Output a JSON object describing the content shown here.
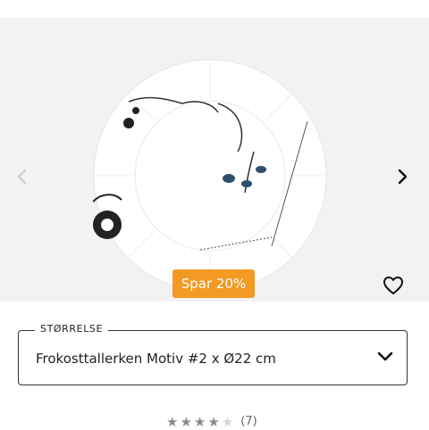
{
  "product": {
    "image": "plate-photo",
    "discount_badge": "Spar 20%",
    "wishlist_icon": "heart-outline-icon",
    "nav_prev_icon": "chevron-left-icon",
    "nav_next_icon": "chevron-right-icon"
  },
  "size_select": {
    "legend": "STØRRELSE",
    "value": "Frokosttallerken Motiv #2 x Ø22 cm",
    "icon": "chevron-down-icon"
  },
  "rating": {
    "stars": 4,
    "max_stars": 5,
    "count_label": "(7)"
  },
  "colors": {
    "badge": "#f29a24",
    "gallery_bg": "#f2f2f2"
  }
}
